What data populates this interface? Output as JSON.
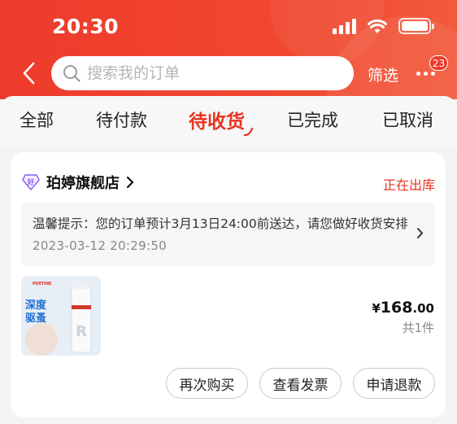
{
  "status_bar": {
    "time": "20:30"
  },
  "search": {
    "placeholder": "搜索我的订单"
  },
  "header": {
    "filter_label": "筛选",
    "more_badge": "23"
  },
  "tabs": [
    {
      "label": "全部"
    },
    {
      "label": "待付款"
    },
    {
      "label": "待收货"
    },
    {
      "label": "已完成"
    },
    {
      "label": "已取消"
    }
  ],
  "active_tab": "待收货",
  "order": {
    "shop_badge": "好",
    "shop_name": "珀婷旗舰店",
    "status": "正在出库",
    "tip_text": "温馨提示：您的订单预计3月13日24:00前送达，请您做好收货安排",
    "tip_date": "2023-03-12 20:29:50",
    "product_image": {
      "brand": "PERTINE",
      "headline_1": "深度",
      "headline_2": "驱蚤",
      "bottle_letter": "R"
    },
    "price_currency": "¥",
    "price_integer": "168",
    "price_decimal": ".00",
    "quantity": "共1件",
    "buttons": {
      "buy_again": "再次购买",
      "view_invoice": "查看发票",
      "refund": "申请退款"
    }
  },
  "colors": {
    "header_red": "#ef3b2c",
    "accent_red": "#e8331f",
    "shop_badge_purple": "#8b5cf6"
  }
}
